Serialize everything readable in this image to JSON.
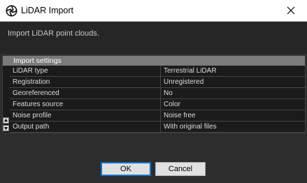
{
  "window": {
    "title": "LiDAR Import",
    "app_icon": "aperture-icon",
    "close_icon": "close-icon"
  },
  "description": "Import LiDAR point clouds.",
  "settings": {
    "header": "Import settings",
    "rows": [
      {
        "property": "LiDAR type",
        "value": "Terrestrial LiDAR"
      },
      {
        "property": "Registration",
        "value": "Unregistered"
      },
      {
        "property": "Georeferenced",
        "value": "No"
      },
      {
        "property": "Features source",
        "value": "Color"
      },
      {
        "property": "Noise profile",
        "value": "Noise free"
      },
      {
        "property": "Output path",
        "value": "With original files"
      }
    ]
  },
  "buttons": {
    "ok": "OK",
    "cancel": "Cancel"
  },
  "colors": {
    "accent": "#0078d7",
    "background": "#2d2d2d",
    "header": "#7a7a7a"
  }
}
